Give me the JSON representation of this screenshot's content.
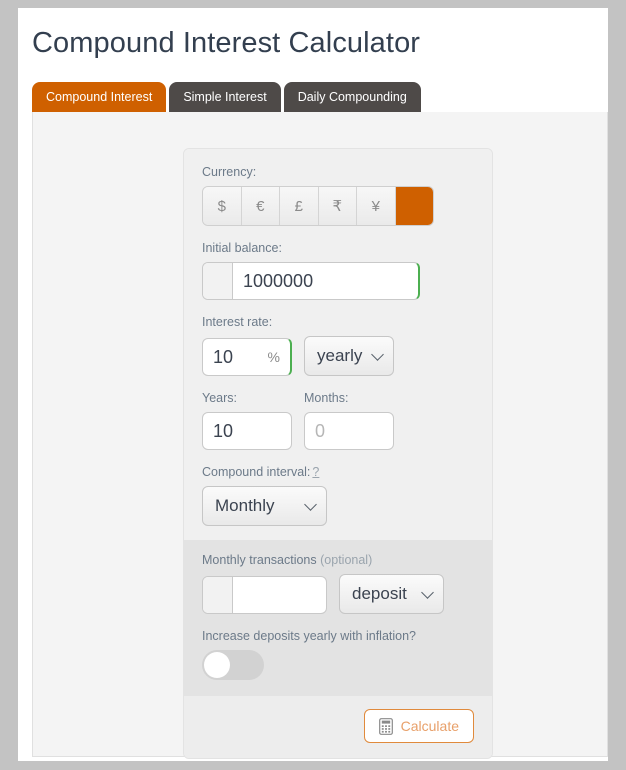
{
  "page": {
    "title": "Compound Interest Calculator"
  },
  "tabs": [
    {
      "label": "Compound Interest",
      "active": true
    },
    {
      "label": "Simple Interest",
      "active": false
    },
    {
      "label": "Daily Compounding",
      "active": false
    }
  ],
  "form": {
    "currency": {
      "label": "Currency:",
      "options": [
        {
          "symbol": "$",
          "selected": false
        },
        {
          "symbol": "€",
          "selected": false
        },
        {
          "symbol": "£",
          "selected": false
        },
        {
          "symbol": "₹",
          "selected": false
        },
        {
          "symbol": "¥",
          "selected": false
        },
        {
          "symbol": "",
          "selected": true
        }
      ]
    },
    "initial_balance": {
      "label": "Initial balance:",
      "prefix": "",
      "value": "1000000",
      "placeholder": ""
    },
    "interest_rate": {
      "label": "Interest rate:",
      "value": "10",
      "placeholder": "",
      "suffix": "%",
      "period": "yearly"
    },
    "years": {
      "label": "Years:",
      "value": "10",
      "placeholder": ""
    },
    "months": {
      "label": "Months:",
      "value": "",
      "placeholder": "0"
    },
    "compound_interval": {
      "label": "Compound interval:",
      "help": "?",
      "value": "Monthly"
    },
    "monthly_transactions": {
      "label": "Monthly transactions",
      "optional_text": "(optional)",
      "prefix": "",
      "value": "",
      "placeholder": "",
      "type": "deposit"
    },
    "inflation": {
      "label": "Increase deposits yearly with inflation?",
      "state": "off"
    },
    "calculate": {
      "label": "Calculate",
      "icon": "calculator-icon"
    }
  },
  "colors": {
    "accent": "#cf6000",
    "tab_inactive": "#4e4a48",
    "title": "#333f4f",
    "label": "#6c7a89",
    "page_bg": "#c3c3c3",
    "valid_border": "#4caf50",
    "calc_border": "#e08a3c",
    "calc_text": "#e8a06a"
  }
}
